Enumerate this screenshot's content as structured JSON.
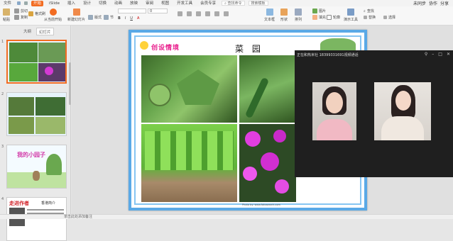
{
  "menubar": {
    "file_menu": "文件",
    "tabs": [
      "开始",
      "iSlide",
      "插入",
      "设计",
      "切换",
      "动画",
      "放映",
      "审阅",
      "视图",
      "开发工具",
      "会员专享"
    ],
    "active_tab": "开始",
    "search_cmd": "查找命令",
    "search_template": "搜索模板",
    "unsync": "未同步",
    "collab": "协作",
    "share": "分享"
  },
  "ribbon": {
    "paste": "粘贴",
    "cut": "剪切",
    "copy": "复制",
    "format_painter": "格式刷",
    "from_current": "从当前开始",
    "new_slide": "新建幻灯片",
    "layout": "版式",
    "section": "节",
    "font_size": "0",
    "textbox": "文本框",
    "shape": "形状",
    "arrange": "排列",
    "picture": "图片",
    "fill": "填充",
    "outline": "轮廓",
    "presenter_tools": "演示工具",
    "replace": "替换",
    "find": "查找",
    "select": "选择"
  },
  "sidebar": {
    "tab_outline": "大纲",
    "tab_slides": "幻灯片",
    "slides": [
      {
        "num": "1"
      },
      {
        "num": "2"
      },
      {
        "num": "3",
        "text": "我的小园子"
      },
      {
        "num": "4",
        "title": "走进作者",
        "subtitle": "香港简介"
      }
    ]
  },
  "slide": {
    "badge": "创设情境",
    "title": "菜 园",
    "caption": "Photo by: www.fotosearch.com"
  },
  "video_call": {
    "title": "正在和热米社 18399331691视频通话"
  },
  "status": {
    "text": "单击此处添加备注"
  },
  "colors": {
    "accent": "#f26c22",
    "slide_border": "#5aa9e6",
    "badge_text": "#e91e8c",
    "video_bg": "#1f1f1f"
  }
}
